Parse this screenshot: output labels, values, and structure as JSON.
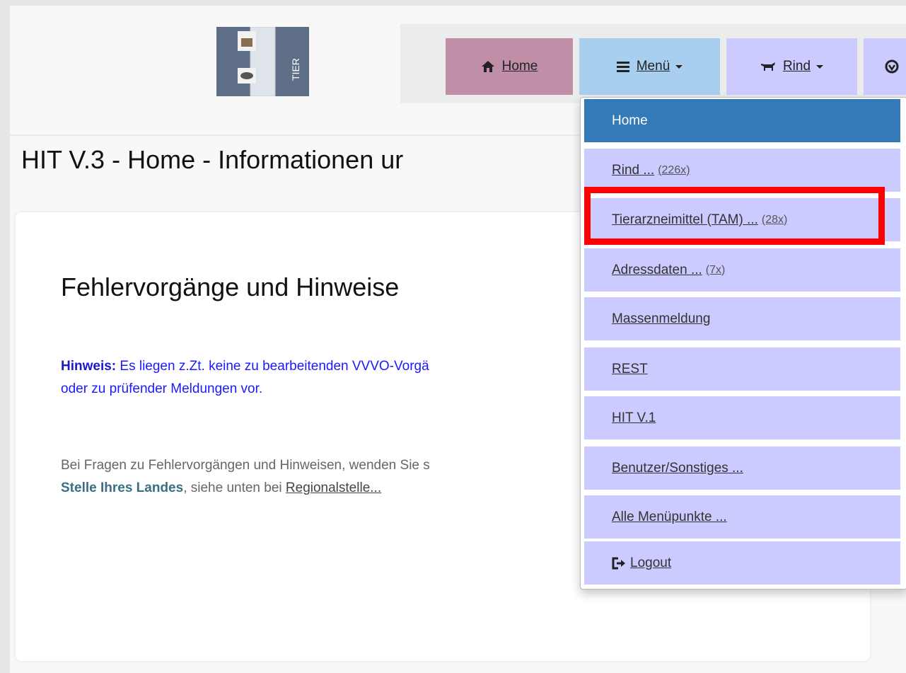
{
  "logo": {
    "text": "TIER",
    "icon": "hit-logo"
  },
  "nav": {
    "home": {
      "label": "Home",
      "icon": "home-icon"
    },
    "menu": {
      "label": "Menü",
      "icon": "hamburger-icon"
    },
    "rind": {
      "label": "Rind",
      "icon": "cow-icon"
    },
    "more": {
      "icon": "shield-icon"
    }
  },
  "page": {
    "title": "HIT V.3 - Home - Informationen ur"
  },
  "card": {
    "title": "Fehlervorgänge und Hinweise",
    "hint_label": "Hinweis:",
    "hint_text": " Es liegen z.Zt. keine zu bearbeitenden VVVO-Vorgä",
    "hint_text2": "oder zu prüfender Meldungen vor.",
    "info_text": "Bei Fragen zu Fehlervorgängen und Hinweisen, wenden Sie s",
    "info_bold": "Stelle Ihres Landes",
    "info_text2": ", siehe unten bei ",
    "info_link": "Regionalstelle..."
  },
  "dropdown": {
    "items": [
      {
        "label": "Home",
        "count": ""
      },
      {
        "label": "Rind ...",
        "count": "(226x)"
      },
      {
        "label": "Tierarzneimittel (TAM) ...",
        "count": "(28x)"
      },
      {
        "label": "Adressdaten ...",
        "count": "(7x)"
      },
      {
        "label": "Massenmeldung",
        "count": ""
      },
      {
        "label": "REST",
        "count": ""
      },
      {
        "label": "HIT V.1",
        "count": ""
      },
      {
        "label": "Benutzer/Sonstiges ...",
        "count": ""
      },
      {
        "label": "Alle Menüpunkte ...",
        "count": ""
      },
      {
        "label": "Logout",
        "count": "",
        "icon": "logout-icon"
      }
    ]
  },
  "colors": {
    "highlight": "#ff0000",
    "active_item": "#337ab7",
    "item_bg": "#cccbff",
    "home_btn": "#c08ea6",
    "menu_btn": "#a9cff0"
  }
}
